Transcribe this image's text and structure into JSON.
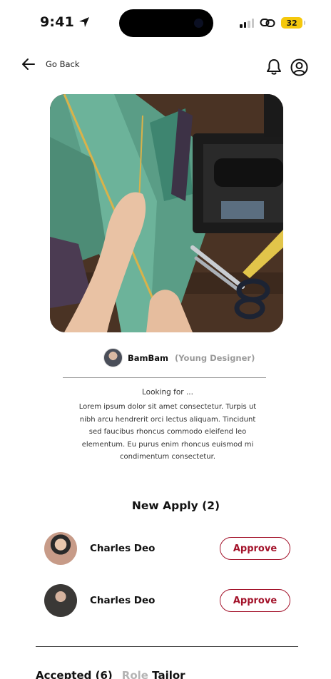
{
  "status_bar": {
    "time": "9:41",
    "battery": "32",
    "battery_color": "#f5c80c"
  },
  "header": {
    "back_label": "Go Back",
    "icons": [
      "arrow-left-icon",
      "bell-icon",
      "user-circle-icon"
    ]
  },
  "post": {
    "author_name": "BamBam",
    "author_role": "(Young Designer)",
    "looking_label": "Looking for ...",
    "description": "Lorem ipsum dolor sit amet consectetur. Turpis ut nibh arcu hendrerit orci lectus aliquam. Tincidunt sed faucibus rhoncus commodo eleifend leo elementum. Eu purus enim rhoncus euismod mi condimentum consectetur."
  },
  "new_apply": {
    "title": "New Apply (2)",
    "applicants": [
      {
        "name": "Charles Deo",
        "action": "Approve"
      },
      {
        "name": "Charles Deo",
        "action": "Approve"
      }
    ]
  },
  "accepted": {
    "label": "Accepted (6)",
    "role_label": "Role",
    "role_value": "Tailor"
  },
  "colors": {
    "accent": "#a3122a",
    "muted": "#9a9a9a"
  }
}
